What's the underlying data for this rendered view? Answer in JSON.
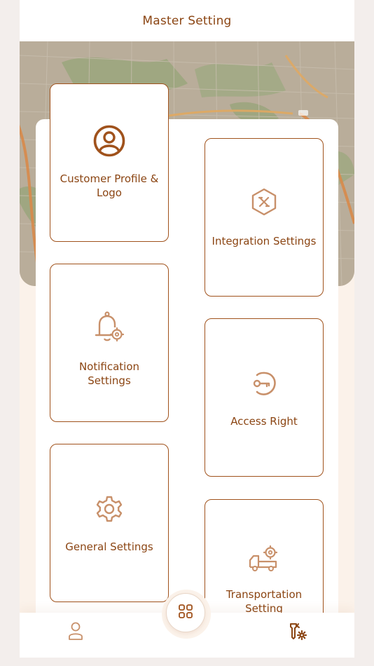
{
  "header": {
    "title": "Master Setting"
  },
  "cards": {
    "customer_profile": {
      "label": "Customer Profile & Logo",
      "icon": "user-circle-icon"
    },
    "integration": {
      "label": "Integration Settings",
      "icon": "hexagon-integration-icon"
    },
    "notification": {
      "label": "Notification Settings",
      "icon": "bell-gear-icon"
    },
    "access_right": {
      "label": "Access Right",
      "icon": "key-icon"
    },
    "general": {
      "label": "General Settings",
      "icon": "gear-icon"
    },
    "transportation": {
      "label": "Transportation Setting",
      "icon": "truck-gear-icon"
    }
  },
  "bottom_nav": {
    "profile_icon": "person-icon",
    "home_icon": "grid-icon",
    "settings_icon": "tools-gear-icon"
  },
  "colors": {
    "accent": "#8b4513",
    "icon_light": "#c8906a",
    "panel": "#ffffff",
    "app_background": "#fbf2ea"
  }
}
